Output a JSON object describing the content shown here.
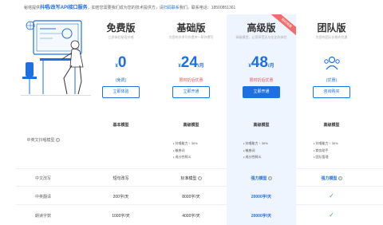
{
  "topbar": {
    "pre": "秘塔提供",
    "highlight": "抖唱/改写API接口服务",
    "mid": "，如若您需要我们成为您的技术提供方，请",
    "link": "扫码联系",
    "post": "我们。联系电话：18500851361"
  },
  "plans": [
    {
      "title": "免费版",
      "subtitle": "立即体验秘塔抖唱",
      "currency": "¥",
      "price": "0",
      "unit": "",
      "note": "(免费)",
      "button": "立即体验",
      "features_title": "基本模型",
      "features": []
    },
    {
      "title": "基础版",
      "subtitle": "为您的学术写作提供一帮你撰写",
      "currency": "¥",
      "price": "24",
      "unit": "/月",
      "note": "限时折后优惠",
      "button": "立即开通",
      "features_title": "高级模型",
      "features": [
        "抖唱能力 ↑ 30%",
        "敏感词",
        "成分性释义"
      ]
    },
    {
      "title": "高级版",
      "subtitle": "高级模型，让您享受无与伦比的体验",
      "currency": "¥",
      "price": "48",
      "unit": "/月",
      "note": "限时折后优惠",
      "button": "立即开通",
      "features_title": "高级模型",
      "features": [
        "抖唱能力 ↑ 30%",
        "敏感词",
        "成分性释义"
      ],
      "ribbon": "限时特惠"
    },
    {
      "title": "团队版",
      "subtitle": "为您的团队价格的优惠",
      "currency": "",
      "price": "",
      "unit": "",
      "note": "(优惠)",
      "button": "咨询购买",
      "features_title": "高级模型",
      "features": [
        "抖唱能力 ↑ 30%",
        "商务助手",
        "团队管理"
      ]
    }
  ],
  "rows": [
    {
      "label": "中英文抖唱模型",
      "values": [
        "",
        "",
        "",
        ""
      ]
    },
    {
      "label": "中文改写",
      "values": [
        "短句改写",
        "标准模型",
        "强力模型",
        "强力模型"
      ]
    },
    {
      "label": "中英翻译",
      "values": [
        "200字/天",
        "8000字/天",
        "20000字/天",
        "check"
      ]
    },
    {
      "label": "朗读字数",
      "values": [
        "1000字/天",
        "4000字/天",
        "20000字/天",
        "check"
      ]
    }
  ],
  "colors": {
    "accent": "#1e6fe0",
    "highlight_bg": "#eef5ff",
    "ribbon": "#f36a6a",
    "check": "#2eb82e"
  }
}
